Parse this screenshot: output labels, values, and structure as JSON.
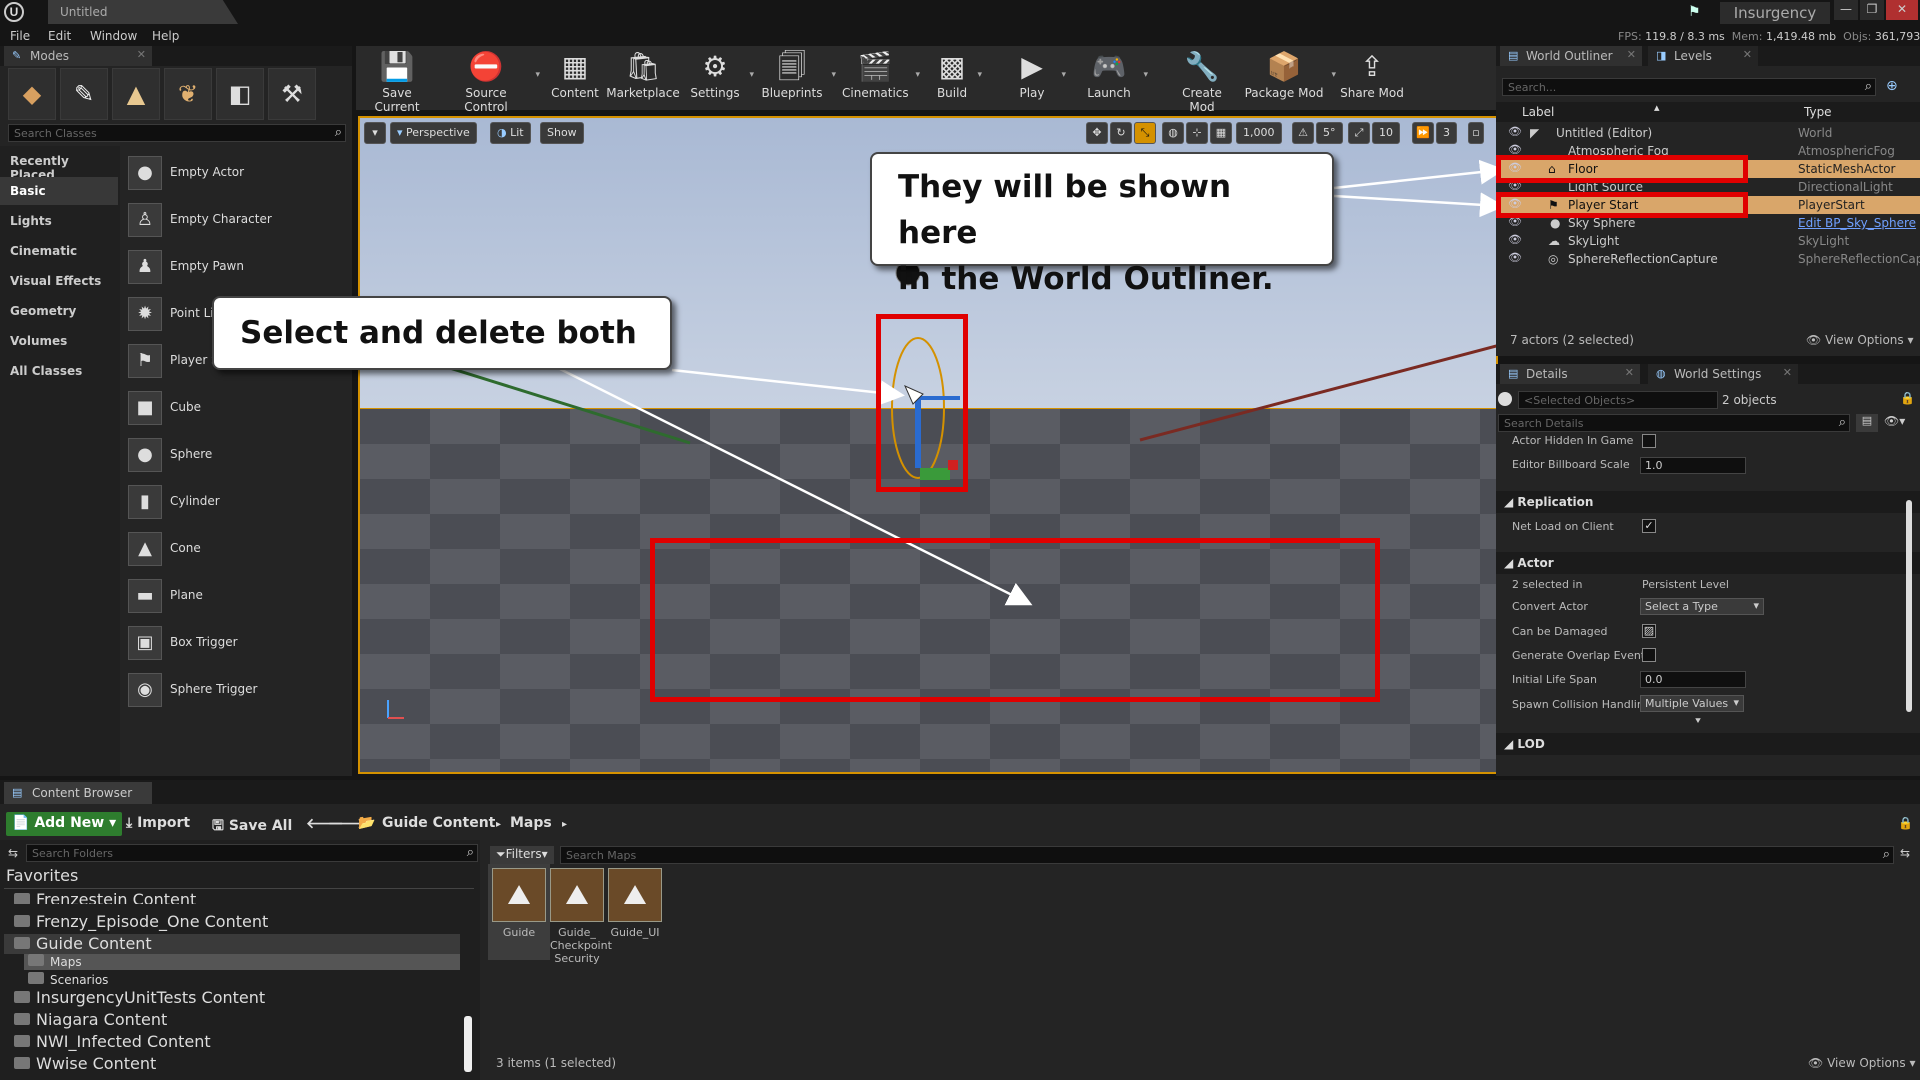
{
  "window": {
    "tab_title": "Untitled",
    "project_name": "Insurgency",
    "logo": "unreal-logo-icon",
    "buttons": [
      "—",
      "❐",
      "✕"
    ]
  },
  "menu": [
    "File",
    "Edit",
    "Window",
    "Help"
  ],
  "stats": {
    "fps_label": "FPS:",
    "fps_value": "119.8 / 8.3 ms",
    "mem_label": "Mem:",
    "mem_value": "1,419.48 mb",
    "objs_label": "Objs:",
    "objs_value": "361,793"
  },
  "modes": {
    "tab_label": "Modes",
    "search_placeholder": "Search Classes",
    "categories": [
      "Recently Placed",
      "Basic",
      "Lights",
      "Cinematic",
      "Visual Effects",
      "Geometry",
      "Volumes",
      "All Classes"
    ],
    "selected_category": "Basic",
    "items": [
      "Empty Actor",
      "Empty Character",
      "Empty Pawn",
      "Point Li",
      "Player S",
      "Cube",
      "Sphere",
      "Cylinder",
      "Cone",
      "Plane",
      "Box Trigger",
      "Sphere Trigger"
    ]
  },
  "toolbar": {
    "buttons": [
      "Save Current",
      "Source Control",
      "Content",
      "Marketplace",
      "Settings",
      "Blueprints",
      "Cinematics",
      "Build",
      "Play",
      "Launch",
      "Create Mod",
      "Package Mod",
      "Share Mod"
    ]
  },
  "viewport": {
    "perspective_label": "Perspective",
    "lit_label": "Lit",
    "show_label": "Show",
    "grid_snap": "1,000",
    "rot_snap": "5°",
    "scale_snap": "10",
    "camera_speed": "3"
  },
  "callouts": {
    "delete": "Select and delete both",
    "outliner_line1": "They will be shown here",
    "outliner_line2": "in the World Outliner."
  },
  "outliner": {
    "tab_label": "World Outliner",
    "levels_tab": "Levels",
    "search_placeholder": "Search...",
    "col_label": "Label",
    "col_type": "Type",
    "rows": [
      {
        "name": "Untitled (Editor)",
        "type": "World"
      },
      {
        "name": "Atmospheric Fog",
        "type": "AtmosphericFog"
      },
      {
        "name": "Floor",
        "type": "StaticMeshActor"
      },
      {
        "name": "Light Source",
        "type": "DirectionalLight"
      },
      {
        "name": "Player Start",
        "type": "PlayerStart"
      },
      {
        "name": "Sky Sphere",
        "type": "Edit BP_Sky_Sphere"
      },
      {
        "name": "SkyLight",
        "type": "SkyLight"
      },
      {
        "name": "SphereReflectionCapture",
        "type": "SphereReflectionCap"
      }
    ],
    "footer": "7 actors (2 selected)",
    "view_options": "View Options"
  },
  "details": {
    "tab_label": "Details",
    "world_settings_tab": "World Settings",
    "selected_placeholder": "<Selected Objects>",
    "objects_count": "2 objects",
    "search_placeholder": "Search Details",
    "actor_hidden": "Actor Hidden In Game",
    "billboard_label": "Editor Billboard Scale",
    "billboard_value": "1.0",
    "replication_section": "Replication",
    "net_load": "Net Load on Client",
    "actor_section": "Actor",
    "selected_in_label": "2 selected in",
    "selected_in_value": "Persistent Level",
    "convert_label": "Convert Actor",
    "convert_value": "Select a Type",
    "damaged_label": "Can be Damaged",
    "overlap_label": "Generate Overlap Events",
    "lifespan_label": "Initial Life Span",
    "lifespan_value": "0.0",
    "collision_label": "Spawn Collision Handling",
    "collision_value": "Multiple Values",
    "lod_section": "LOD"
  },
  "content_browser": {
    "tab_label": "Content Browser",
    "add_new": "Add New",
    "import": "Import",
    "save_all": "Save All",
    "path": [
      "Guide Content",
      "Maps"
    ],
    "search_folders": "Search Folders",
    "favorites": "Favorites",
    "folders": [
      "Frenzestein Content",
      "Frenzy_Episode_One Content",
      "Guide Content",
      "Maps",
      "Scenarios",
      "InsurgencyUnitTests Content",
      "Niagara Content",
      "NWI_Infected Content",
      "Wwise Content"
    ],
    "filters": "Filters",
    "search_maps": "Search Maps",
    "assets": [
      "Guide",
      "Guide_ Checkpoint Security",
      "Guide_UI"
    ],
    "status": "3 items (1 selected)",
    "view_options": "View Options"
  },
  "colors": {
    "accent_orange": "#d49100",
    "selection": "#d9a66a",
    "annotation_red": "#e00000",
    "add_new_green": "#2e7d2e"
  }
}
